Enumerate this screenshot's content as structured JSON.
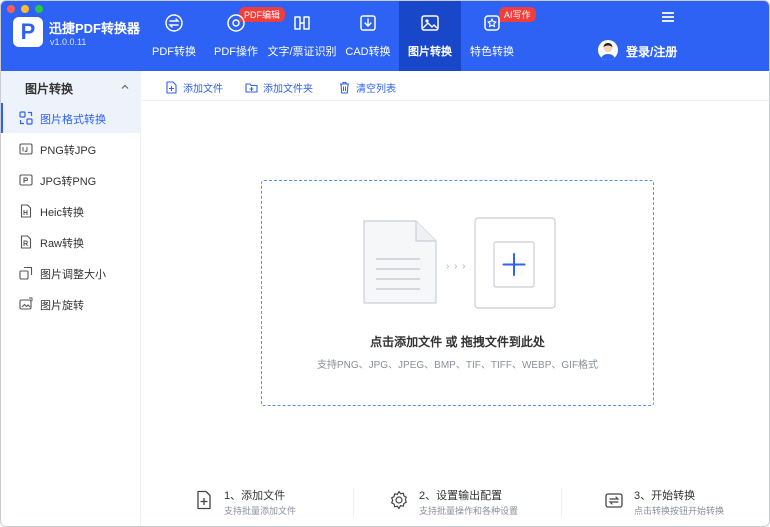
{
  "app": {
    "name": "迅捷PDF转换器",
    "version": "v1.0.0.11",
    "logo_letter": "P"
  },
  "colors": {
    "brand": "#2d62f4",
    "active_nav": "#1947c9",
    "badge": "#f23d3d",
    "traffic_close": "#ff5f57",
    "traffic_min": "#febc2e",
    "traffic_max": "#28c840"
  },
  "nav": {
    "items": [
      {
        "label": "PDF转换",
        "icon": "pdf-convert-icon"
      },
      {
        "label": "PDF操作",
        "icon": "pdf-operate-icon",
        "badge": "PDF编辑"
      },
      {
        "label": "文字/票证识别",
        "icon": "ocr-icon"
      },
      {
        "label": "CAD转换",
        "icon": "cad-icon"
      },
      {
        "label": "图片转换",
        "icon": "image-icon",
        "active": true
      },
      {
        "label": "特色转换",
        "icon": "feature-icon",
        "badge": "AI写作"
      }
    ],
    "login_label": "登录/注册"
  },
  "sidebar": {
    "header": "图片转换",
    "items": [
      {
        "label": "图片格式转换",
        "icon": "image-format-icon",
        "active": true
      },
      {
        "label": "PNG转JPG",
        "icon": "png-to-jpg-icon"
      },
      {
        "label": "JPG转PNG",
        "icon": "jpg-to-png-icon"
      },
      {
        "label": "Heic转换",
        "icon": "heic-icon"
      },
      {
        "label": "Raw转换",
        "icon": "raw-icon"
      },
      {
        "label": "图片调整大小",
        "icon": "resize-icon"
      },
      {
        "label": "图片旋转",
        "icon": "rotate-icon"
      }
    ]
  },
  "toolbar": {
    "add_file": "添加文件",
    "add_folder": "添加文件夹",
    "clear_list": "清空列表"
  },
  "dropzone": {
    "main_text": "点击添加文件 或 拖拽文件到此处",
    "formats_text": "支持PNG、JPG、JPEG、BMP、TIF、TIFF、WEBP、GIF格式",
    "arrows": "› › ›"
  },
  "steps": [
    {
      "title": "1、添加文件",
      "desc": "支持批量添加文件",
      "icon": "add-file-icon"
    },
    {
      "title": "2、设置输出配置",
      "desc": "支持批量操作和各种设置",
      "icon": "settings-gear-icon"
    },
    {
      "title": "3、开始转换",
      "desc": "点击转换按钮开始转换",
      "icon": "convert-icon"
    }
  ]
}
